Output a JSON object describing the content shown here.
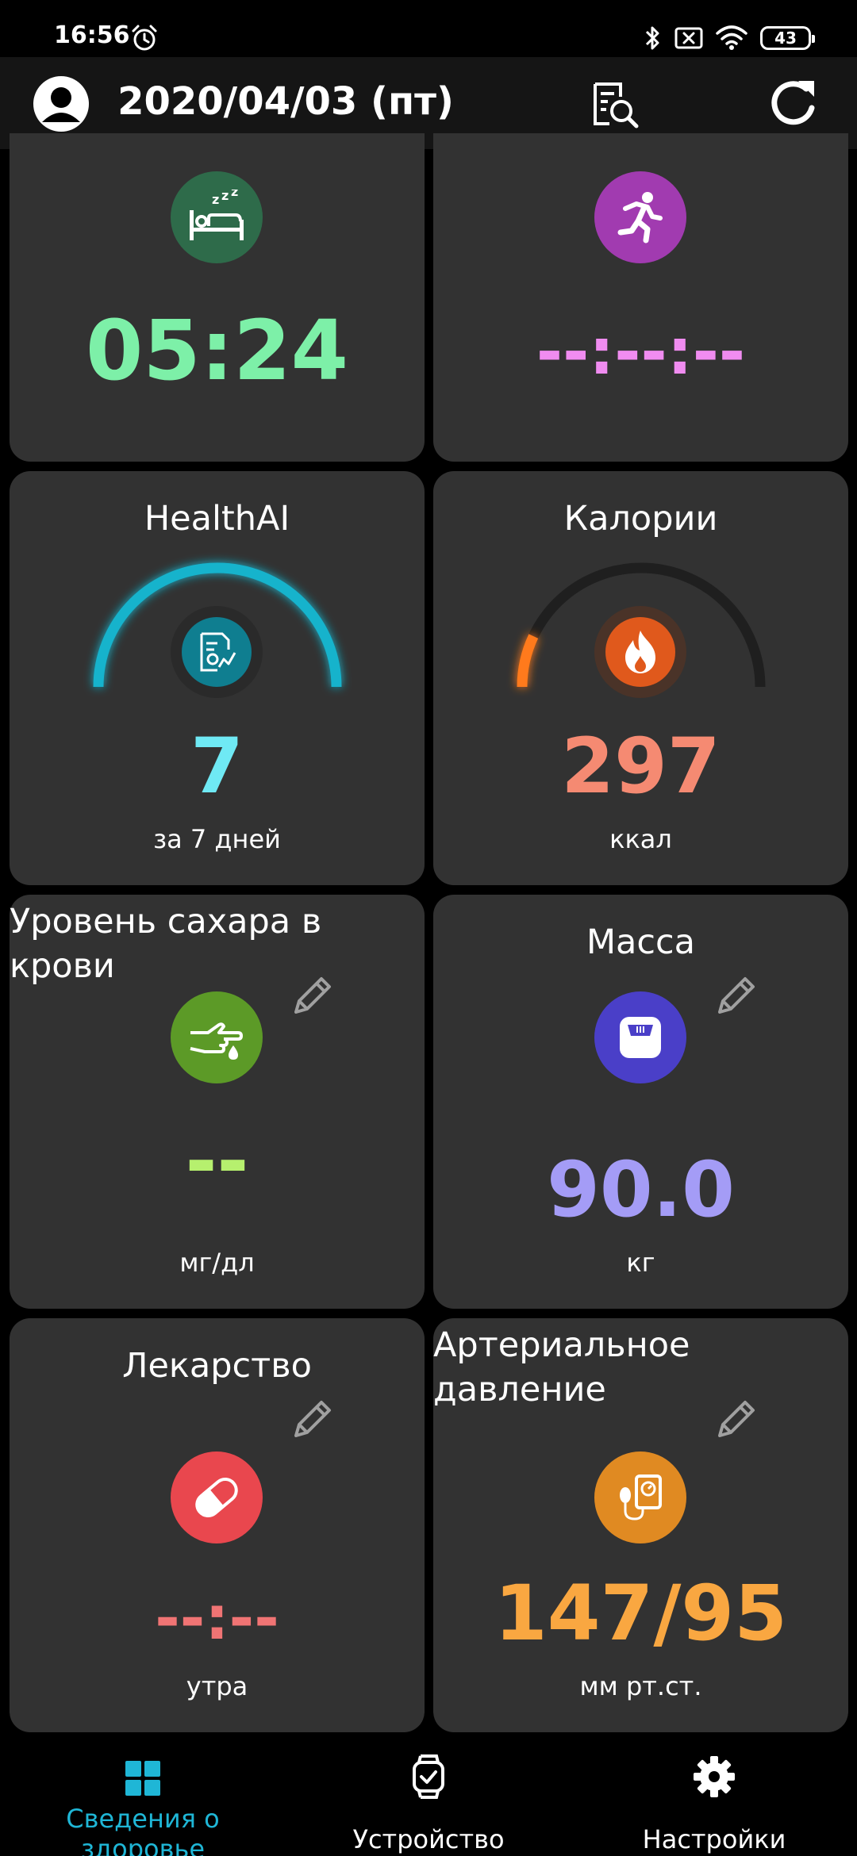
{
  "status_bar": {
    "time": "16:56",
    "battery": "43"
  },
  "header": {
    "date": "2020/04/03 (пт)"
  },
  "cards": {
    "sleep": {
      "value": "05:24",
      "color": "#7DF0A8",
      "icon_bg": "#2E6B4A"
    },
    "exercise": {
      "value": "--:--:--",
      "color": "#F08CF0",
      "icon_bg": "#A13BB0"
    },
    "healthai": {
      "title": "HealthAI",
      "value": "7",
      "unit": "за 7 дней",
      "color": "#6FE9F4",
      "gauge_color": "#19B3CC",
      "gauge_fraction": 1.0
    },
    "calories": {
      "title": "Калории",
      "value": "297",
      "unit": "ккал",
      "color": "#F58A72",
      "gauge_color": "#FF7A1A",
      "gauge_fraction": 0.14
    },
    "glucose": {
      "title": "Уровень сахара в крови",
      "value": "--",
      "unit": "мг/дл",
      "color": "#B6F06E",
      "icon_bg": "#5C9A27"
    },
    "weight": {
      "title": "Масса",
      "value": "90.0",
      "unit": "кг",
      "color": "#A49CF6",
      "icon_bg": "#4A3FC8"
    },
    "medicine": {
      "title": "Лекарство",
      "value": "--:--",
      "unit": "утра",
      "color": "#F07474",
      "icon_bg": "#E9474E"
    },
    "pressure": {
      "title": "Артериальное давление",
      "value": "147/95",
      "unit": "мм рт.ст.",
      "color": "#F9A741",
      "icon_bg": "#E08A22"
    }
  },
  "bottom_nav": [
    {
      "label": "Сведения о здоровье",
      "active": true,
      "color": "#1FB6D6"
    },
    {
      "label": "Устройство",
      "active": false
    },
    {
      "label": "Настройки",
      "active": false
    }
  ]
}
